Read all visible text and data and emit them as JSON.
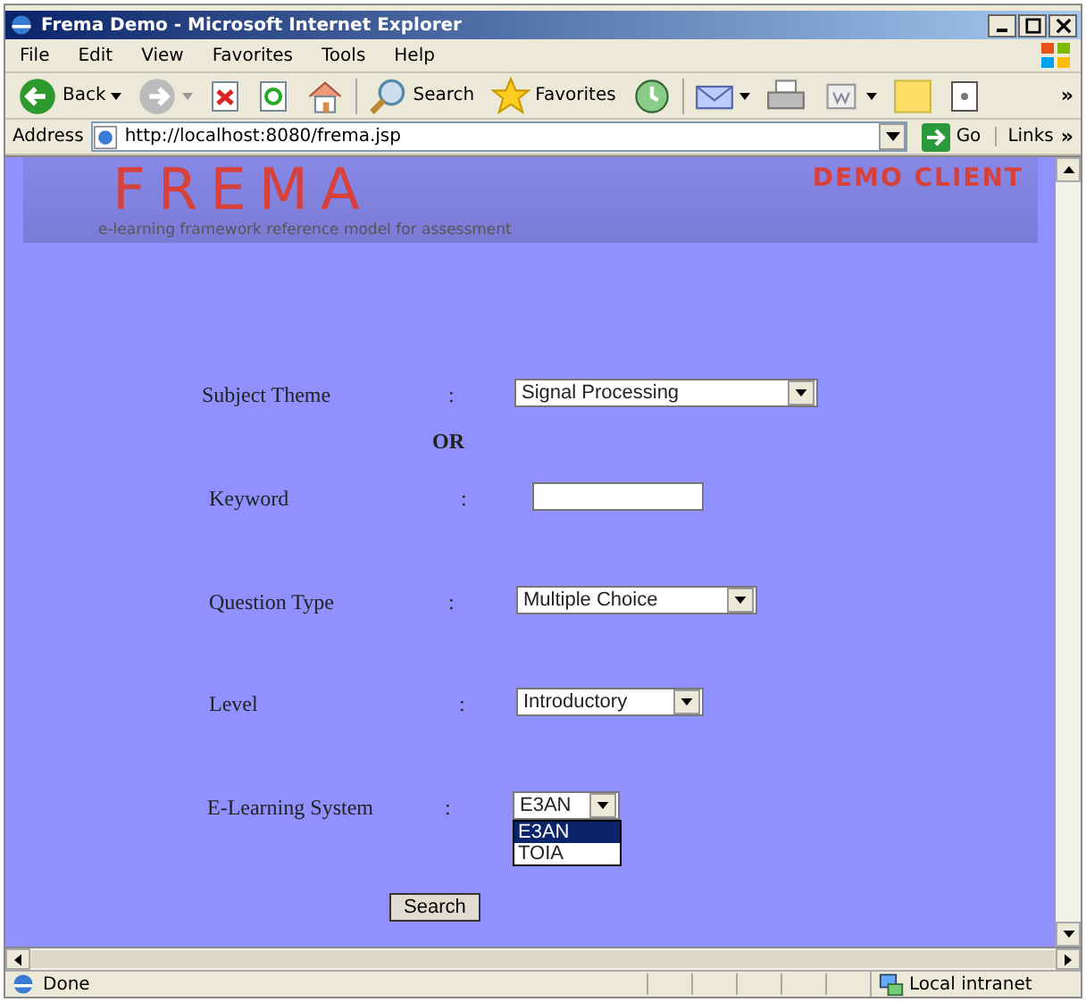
{
  "window": {
    "title": "Frema Demo - Microsoft Internet Explorer"
  },
  "menu": [
    "File",
    "Edit",
    "View",
    "Favorites",
    "Tools",
    "Help"
  ],
  "toolbar": [
    {
      "kind": "back",
      "label": "Back"
    },
    {
      "kind": "forward"
    },
    {
      "kind": "stop"
    },
    {
      "kind": "refresh"
    },
    {
      "kind": "home"
    },
    {
      "kind": "search",
      "label": "Search"
    },
    {
      "kind": "favorites",
      "label": "Favorites"
    },
    {
      "kind": "history"
    },
    {
      "kind": "mail"
    },
    {
      "kind": "print"
    },
    {
      "kind": "edit"
    },
    {
      "kind": "note"
    },
    {
      "kind": "messenger"
    }
  ],
  "address": {
    "label": "Address",
    "url": "http://localhost:8080/frema.jsp",
    "go": "Go",
    "links": "Links",
    "more": "»"
  },
  "toolbar_more": "»",
  "banner": {
    "logo": "FREMA",
    "tagline": "e-learning framework reference model for assessment",
    "client": "DEMO CLIENT"
  },
  "form": [
    {
      "kind": "select",
      "label": "Subject Theme",
      "colon": ":",
      "value": "Signal Processing"
    },
    {
      "kind": "separator",
      "label": "OR"
    },
    {
      "kind": "text",
      "label": "Keyword",
      "colon": ":"
    },
    {
      "kind": "select",
      "label": "Question Type",
      "colon": ":",
      "value": "Multiple Choice"
    },
    {
      "kind": "select",
      "label": "Level",
      "colon": ":",
      "value": "Introductory"
    },
    {
      "kind": "select",
      "label": "E-Learning System",
      "colon": ":",
      "value": "E3AN",
      "expanded": true,
      "options": [
        {
          "label": "E3AN",
          "selected": true
        },
        {
          "label": "TOIA",
          "selected": false
        }
      ]
    }
  ],
  "search_button": "Search",
  "status_bar": {
    "text": "Done",
    "zone": "Local intranet"
  }
}
